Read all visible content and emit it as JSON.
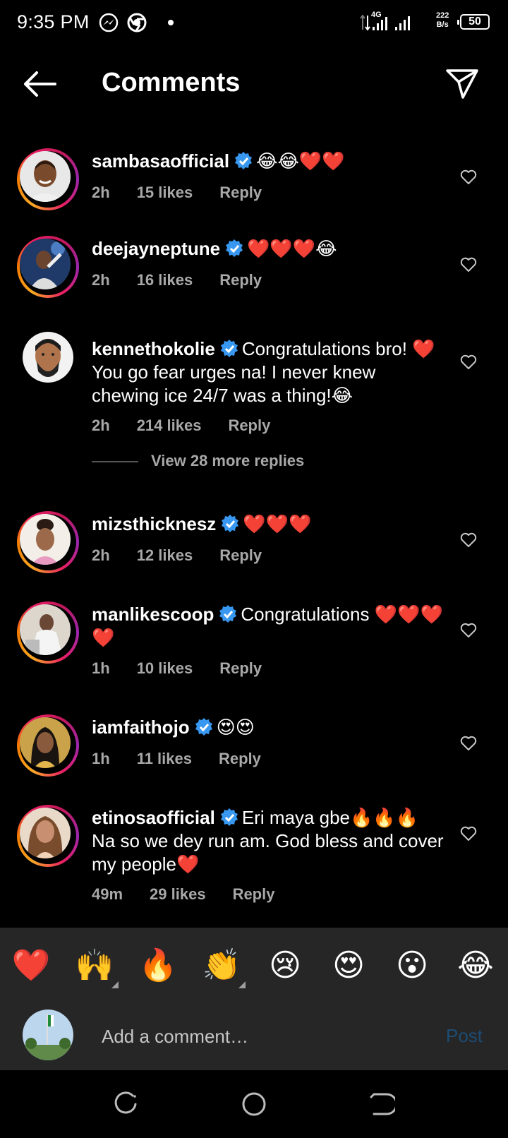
{
  "status_bar": {
    "time": "9:35 PM",
    "icons": [
      "messenger-icon",
      "chrome-icon",
      "notification-dot"
    ],
    "signal": [
      "data-arrows-icon",
      "4g-signal-icon",
      "signal-icon"
    ],
    "net_speed_value": "222",
    "net_speed_unit": "B/s",
    "battery": "50"
  },
  "header": {
    "title": "Comments",
    "back_icon": "arrow-left-icon",
    "share_icon": "send-icon"
  },
  "comments": [
    {
      "username": "sambasaofficial",
      "text": "😂😂❤️❤️",
      "time": "2h",
      "likes": "15 likes",
      "reply": "Reply"
    },
    {
      "username": "deejayneptune",
      "text": "❤️❤️❤️😂",
      "time": "2h",
      "likes": "16 likes",
      "reply": "Reply"
    },
    {
      "username": "kennethokolie",
      "text": "Congratulations bro! ❤️ You go fear urges na! I never knew chewing ice 24/7 was a thing!😂",
      "time": "2h",
      "likes": "214 likes",
      "reply": "Reply"
    },
    {
      "username": "mizsthicknesz",
      "text": "❤️❤️❤️",
      "time": "2h",
      "likes": "12 likes",
      "reply": "Reply"
    },
    {
      "username": "manlikescoop",
      "text": "Congratulations ❤️❤️❤️❤️",
      "time": "1h",
      "likes": "10 likes",
      "reply": "Reply"
    },
    {
      "username": "iamfaithojo",
      "text": "😍😍",
      "time": "1h",
      "likes": "11 likes",
      "reply": "Reply"
    },
    {
      "username": "etinosaofficial",
      "text": "Eri maya gbe🔥🔥🔥 Na so we dey run am. God bless and cover my people❤️",
      "time": "49m",
      "likes": "29 likes",
      "reply": "Reply"
    }
  ],
  "view_more_replies": "View 28 more replies",
  "emoji_bar": [
    "❤️",
    "🙌",
    "🔥",
    "👏",
    "😢",
    "😍",
    "😮",
    "😂"
  ],
  "add_comment": {
    "placeholder": "Add a comment…",
    "post_label": "Post"
  },
  "nav_bar": [
    "recent-apps-icon",
    "home-icon",
    "back-icon"
  ],
  "colors": {
    "background": "#000000",
    "verified": "#3897f0",
    "meta_text": "#a8a8a8",
    "post_disabled": "#1c4c74",
    "bottom_panel": "#262626"
  }
}
